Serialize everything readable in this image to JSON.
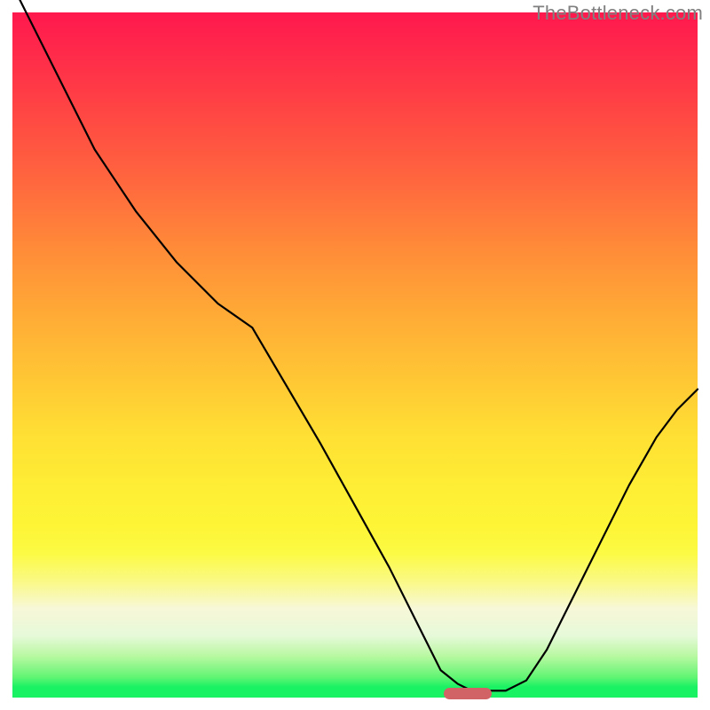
{
  "watermark": "TheBottleneck.com",
  "chart_data": {
    "type": "line",
    "title": "",
    "xlabel": "",
    "ylabel": "",
    "xlim": [
      0,
      100
    ],
    "ylim": [
      0,
      100
    ],
    "curve": {
      "x": [
        0,
        6,
        12,
        18,
        24,
        30,
        35,
        40,
        45,
        50,
        55,
        60,
        62.5,
        65,
        67,
        70,
        72,
        75,
        78,
        82,
        86,
        90,
        94,
        97,
        100
      ],
      "y": [
        104,
        92,
        80,
        71,
        63.5,
        57.5,
        54,
        45.5,
        37,
        28,
        19,
        9,
        4,
        2,
        1,
        1,
        1,
        2.5,
        7,
        15,
        23,
        31,
        38,
        42,
        45
      ]
    },
    "marker": {
      "x_center": 66.5,
      "width": 7,
      "y": 0.6
    },
    "background_gradient": "red-yellow-green vertical",
    "annotations": []
  }
}
